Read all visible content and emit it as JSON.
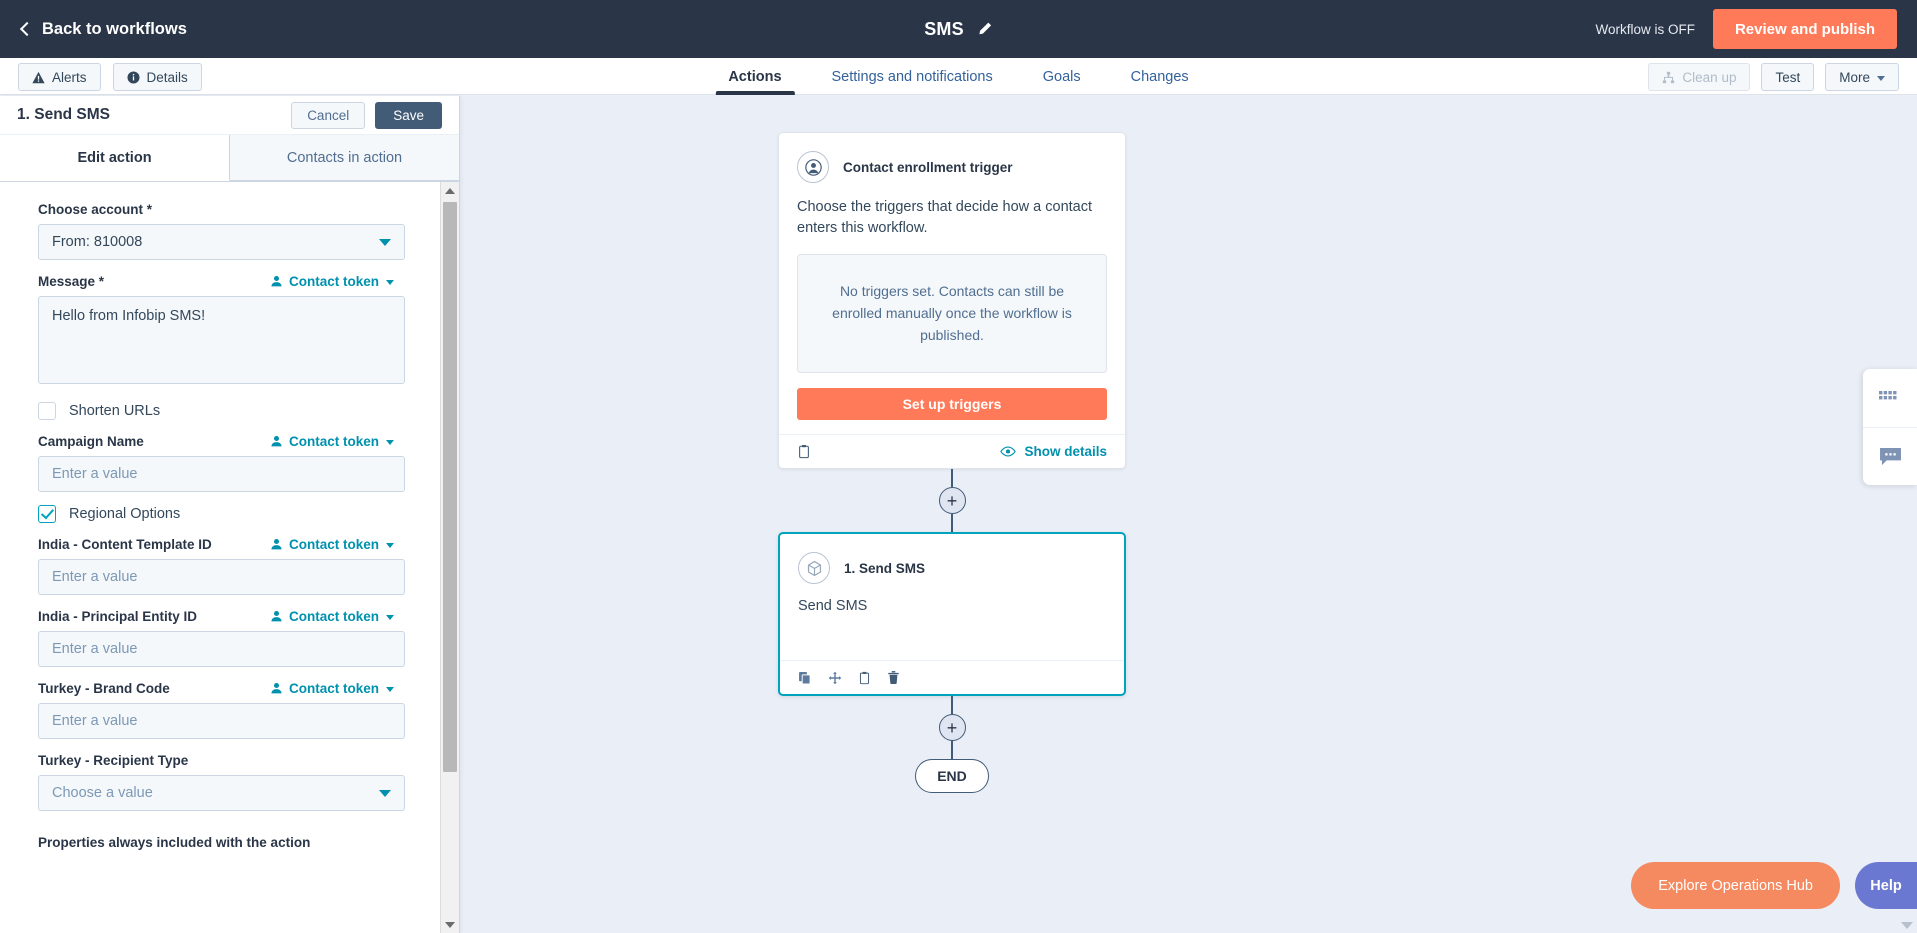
{
  "topbar": {
    "back_label": "Back to workflows",
    "workflow_title": "SMS",
    "status_text": "Workflow is OFF",
    "publish_label": "Review and publish"
  },
  "subbar": {
    "alerts_label": "Alerts",
    "details_label": "Details",
    "cleanup_label": "Clean up",
    "test_label": "Test",
    "more_label": "More",
    "tabs": [
      {
        "label": "Actions",
        "active": true
      },
      {
        "label": "Settings and notifications",
        "active": false
      },
      {
        "label": "Goals",
        "active": false
      },
      {
        "label": "Changes",
        "active": false
      }
    ]
  },
  "panel": {
    "title": "1. Send SMS",
    "cancel_label": "Cancel",
    "save_label": "Save",
    "tabs": [
      {
        "label": "Edit action",
        "active": true
      },
      {
        "label": "Contacts in action",
        "active": false
      }
    ],
    "token_label": "Contact token",
    "fields": {
      "account_label": "Choose account *",
      "account_value": "From: 810008",
      "message_label": "Message *",
      "message_value": "Hello from Infobip SMS!",
      "shorten_urls_label": "Shorten URLs",
      "shorten_urls_checked": false,
      "campaign_label": "Campaign Name",
      "campaign_placeholder": "Enter a value",
      "regional_label": "Regional Options",
      "regional_checked": true,
      "india_template_label": "India - Content Template ID",
      "india_template_placeholder": "Enter a value",
      "india_entity_label": "India - Principal Entity ID",
      "india_entity_placeholder": "Enter a value",
      "turkey_brand_label": "Turkey - Brand Code",
      "turkey_brand_placeholder": "Enter a value",
      "turkey_recipient_label": "Turkey - Recipient Type",
      "turkey_recipient_value": "Choose a value",
      "properties_note": "Properties always included with the action"
    }
  },
  "canvas": {
    "trigger_card": {
      "title": "Contact enrollment trigger",
      "description": "Choose the triggers that decide how a contact enters this workflow.",
      "empty_text": "No triggers set. Contacts can still be enrolled manually once the workflow is published.",
      "button_label": "Set up triggers",
      "show_details_label": "Show details"
    },
    "action_card": {
      "title": "1. Send SMS",
      "body": "Send SMS"
    },
    "end_label": "END",
    "plus_label": "+"
  },
  "floating": {
    "ops_hub_label": "Explore Operations Hub",
    "help_label": "Help"
  },
  "colors": {
    "header_navy": "#2a3647",
    "accent_orange": "#ff7a59",
    "link_teal": "#0091ae",
    "selected_cyan": "#00a4bd",
    "canvas_bg": "#eaeef6",
    "help_purple": "#6a78d1"
  }
}
